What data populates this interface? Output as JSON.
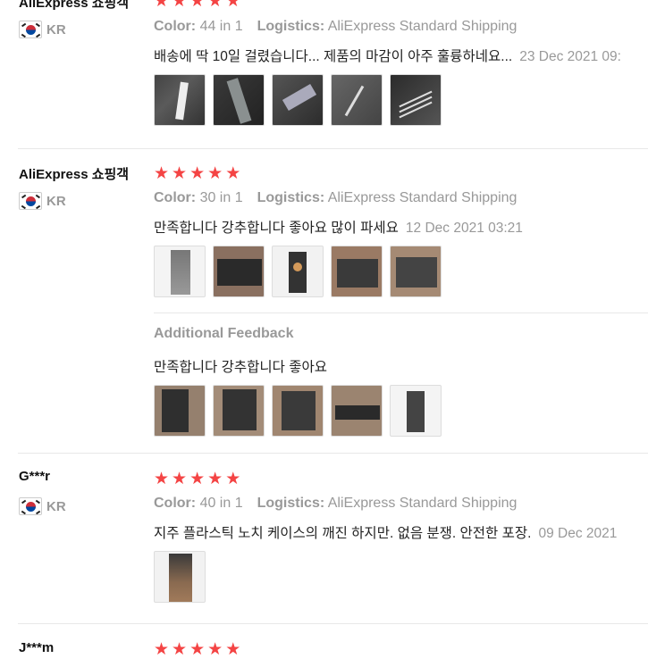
{
  "reviews": [
    {
      "user": "AliExpress 쇼핑객",
      "country": "KR",
      "stars": 5,
      "color_label": "Color:",
      "color_value": "44 in 1",
      "logistics_label": "Logistics:",
      "logistics_value": "AliExpress Standard Shipping",
      "text": "배송에 딱 10일 걸렸습니다... 제품의 마감이 아주 훌륭하네요...",
      "date": "23 Dec 2021 09:",
      "photo_count": 5
    },
    {
      "user": "AliExpress 쇼핑객",
      "country": "KR",
      "stars": 5,
      "color_label": "Color:",
      "color_value": "30 in 1",
      "logistics_label": "Logistics:",
      "logistics_value": "AliExpress Standard Shipping",
      "text": "만족합니다 강추합니다 좋아요 많이 파세요",
      "date": "12 Dec 2021 03:21",
      "photo_count": 5,
      "additional_feedback": {
        "title": "Additional Feedback",
        "text": "만족합니다 강추합니다 좋아요",
        "photo_count": 5
      }
    },
    {
      "user": "G***r",
      "country": "KR",
      "stars": 5,
      "color_label": "Color:",
      "color_value": "40 in 1",
      "logistics_label": "Logistics:",
      "logistics_value": "AliExpress Standard Shipping",
      "text": "지주 플라스틱 노치 케이스의 깨진 하지만. 없음 분쟁. 안전한 포장.",
      "date": "09 Dec 2021",
      "photo_count": 1
    },
    {
      "user": "J***m",
      "stars": 5
    }
  ],
  "colors": {
    "star": "#f44444",
    "muted": "#999999",
    "text": "#222222"
  },
  "icons": {
    "star": "star-icon",
    "flag": "south-korea-flag-icon"
  }
}
